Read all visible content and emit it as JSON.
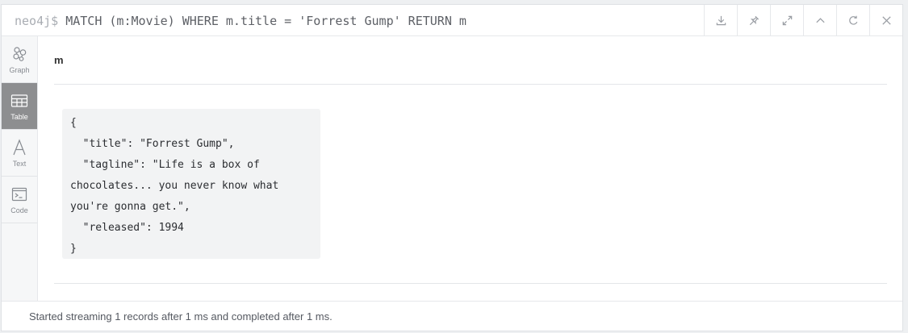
{
  "header": {
    "prompt": "neo4j$",
    "query": "MATCH (m:Movie) WHERE m.title = 'Forrest Gump' RETURN m",
    "actions": [
      {
        "icon": "download-icon"
      },
      {
        "icon": "pin-icon"
      },
      {
        "icon": "expand-icon"
      },
      {
        "icon": "collapse-up-icon"
      },
      {
        "icon": "rerun-icon"
      },
      {
        "icon": "close-icon"
      }
    ]
  },
  "sidenav": {
    "items": [
      {
        "label": "Graph",
        "icon": "graph-icon",
        "active": false
      },
      {
        "label": "Table",
        "icon": "table-icon",
        "active": true
      },
      {
        "label": "Text",
        "icon": "text-icon",
        "active": false
      },
      {
        "label": "Code",
        "icon": "code-icon",
        "active": false
      }
    ]
  },
  "result": {
    "column_header": "m",
    "lines": [
      "{",
      "  \"title\": \"Forrest Gump\",",
      "  \"tagline\": \"Life is a box of",
      "chocolates... you never know what",
      "you're gonna get.\",",
      "  \"released\": 1994",
      "}"
    ]
  },
  "footer": {
    "status": "Started streaming 1 records after 1 ms and completed after 1 ms."
  },
  "colors": {
    "active_nav": "#8d8e90",
    "nav_bg": "#f6f7f8",
    "code_bg": "#f2f3f4"
  }
}
